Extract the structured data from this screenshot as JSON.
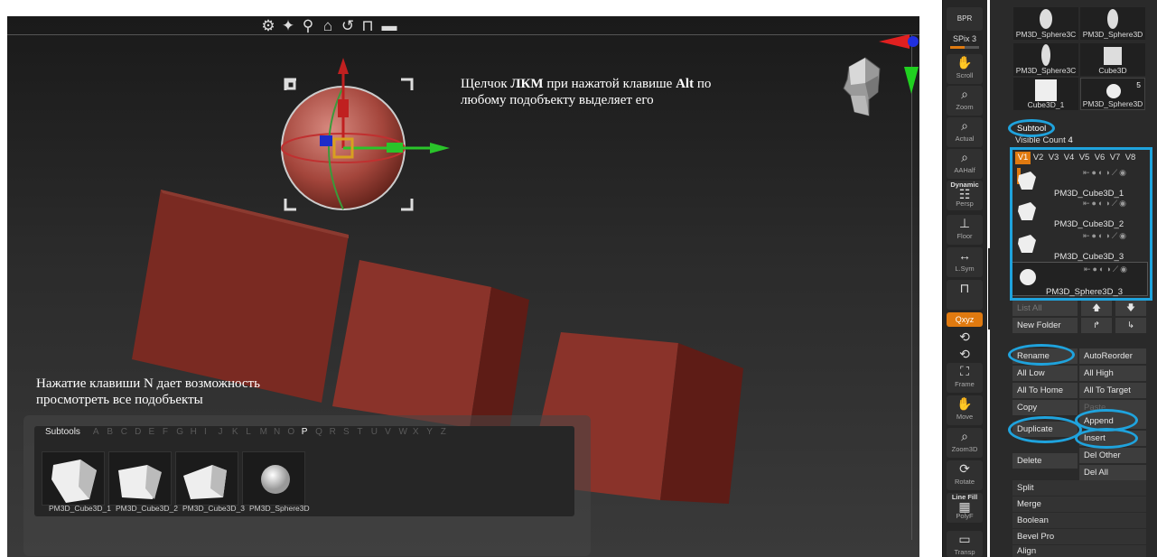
{
  "viewport": {
    "toolbar_icons": [
      "gear-icon",
      "pin-icon",
      "location-icon",
      "home-icon",
      "undo-icon",
      "lock-icon",
      "minus-icon"
    ],
    "annotation_top_line1_pre": "Щелчок ",
    "annotation_top_line1_bold": "ЛКМ",
    "annotation_top_line1_mid": " при нажатой клавише ",
    "annotation_top_line1_bold2": "Alt",
    "annotation_top_line1_post": " по",
    "annotation_top_line2": "любому подобъекту выделяет его",
    "annotation_bottom_line1": "Нажатие клавиши N дает возможность",
    "annotation_bottom_line2": "просмотреть все подобъекты",
    "cube_color": "#7a2a22",
    "subtools_popup": {
      "title": "Subtools",
      "letters": [
        "A",
        "B",
        "C",
        "D",
        "E",
        "F",
        "G",
        "H",
        "I",
        "J",
        "K",
        "L",
        "M",
        "N",
        "O",
        "P",
        "Q",
        "R",
        "S",
        "T",
        "U",
        "V",
        "W",
        "X",
        "Y",
        "Z"
      ],
      "active_letter": "P",
      "items": [
        "PM3D_Cube3D_1",
        "PM3D_Cube3D_2",
        "PM3D_Cube3D_3",
        "PM3D_Sphere3D"
      ],
      "labels_shown": [
        "PM3D_Cube3D_1",
        "PM3D_Cube3D_2",
        "PM3D_Cube3D_3",
        "PM3D_Sphere3D"
      ]
    }
  },
  "toolcol": {
    "tools": [
      {
        "label": "BPR",
        "icon": "bpr-icon"
      },
      {
        "label": "SPix 3",
        "icon": "spix-slider"
      },
      {
        "label": "Scroll",
        "icon": "scroll-icon"
      },
      {
        "label": "Zoom",
        "icon": "zoom-icon"
      },
      {
        "label": "Actual",
        "icon": "actual-icon"
      },
      {
        "label": "AAHalf",
        "icon": "aahalf-icon"
      },
      {
        "label": "Dynamic",
        "label2": "Persp",
        "icon": "persp-icon"
      },
      {
        "label": "Floor",
        "icon": "floor-icon"
      },
      {
        "label": "L.Sym",
        "icon": "lsym-icon"
      },
      {
        "label": "",
        "icon": "lock-camera-icon"
      },
      {
        "label": "Qxyz",
        "icon": "xyz-icon"
      },
      {
        "label": "Frame",
        "icon": "frame-icon"
      },
      {
        "label": "Move",
        "icon": "move-icon"
      },
      {
        "label": "Zoom3D",
        "icon": "zoom3d-icon"
      },
      {
        "label": "Rotate",
        "icon": "rotate-icon"
      },
      {
        "label": "Line Fill",
        "label2": "PolyF",
        "icon": "polyf-icon"
      },
      {
        "label": "Transp",
        "icon": "transp-icon"
      }
    ]
  },
  "panel": {
    "thumbs": [
      {
        "label": "PM3D_Sphere3C"
      },
      {
        "label": "PM3D_Sphere3D"
      },
      {
        "label": "PM3D_Sphere3C"
      },
      {
        "label": "Cube3D"
      },
      {
        "label": "Cube3D_1"
      },
      {
        "label": "PM3D_Sphere3D",
        "count": "5"
      }
    ],
    "subtool_header": "Subtool",
    "visible_count_label": "Visible Count",
    "visible_count_value": "4",
    "vtabs": [
      "V1",
      "V2",
      "V3",
      "V4",
      "V5",
      "V6",
      "V7",
      "V8"
    ],
    "subtools": [
      "PM3D_Cube3D_1",
      "PM3D_Cube3D_2",
      "PM3D_Cube3D_3",
      "PM3D_Sphere3D_3"
    ],
    "list_all": "List All",
    "new_folder": "New Folder",
    "buttons": {
      "rename": "Rename",
      "autoreorder": "AutoReorder",
      "all_low": "All Low",
      "all_high": "All High",
      "all_to_home": "All To Home",
      "all_to_target": "All To Target",
      "copy": "Copy",
      "paste": "Paste",
      "append": "Append",
      "duplicate": "Duplicate",
      "insert": "Insert",
      "del_other": "Del Other",
      "delete": "Delete",
      "del_all": "Del All",
      "split": "Split",
      "merge": "Merge",
      "boolean": "Boolean",
      "bevel_pro": "Bevel Pro",
      "align": "Align"
    }
  },
  "colors": {
    "highlight": "#1fa3dd",
    "accent_orange": "#e07a10",
    "panel_bg": "#2a2a2a"
  }
}
